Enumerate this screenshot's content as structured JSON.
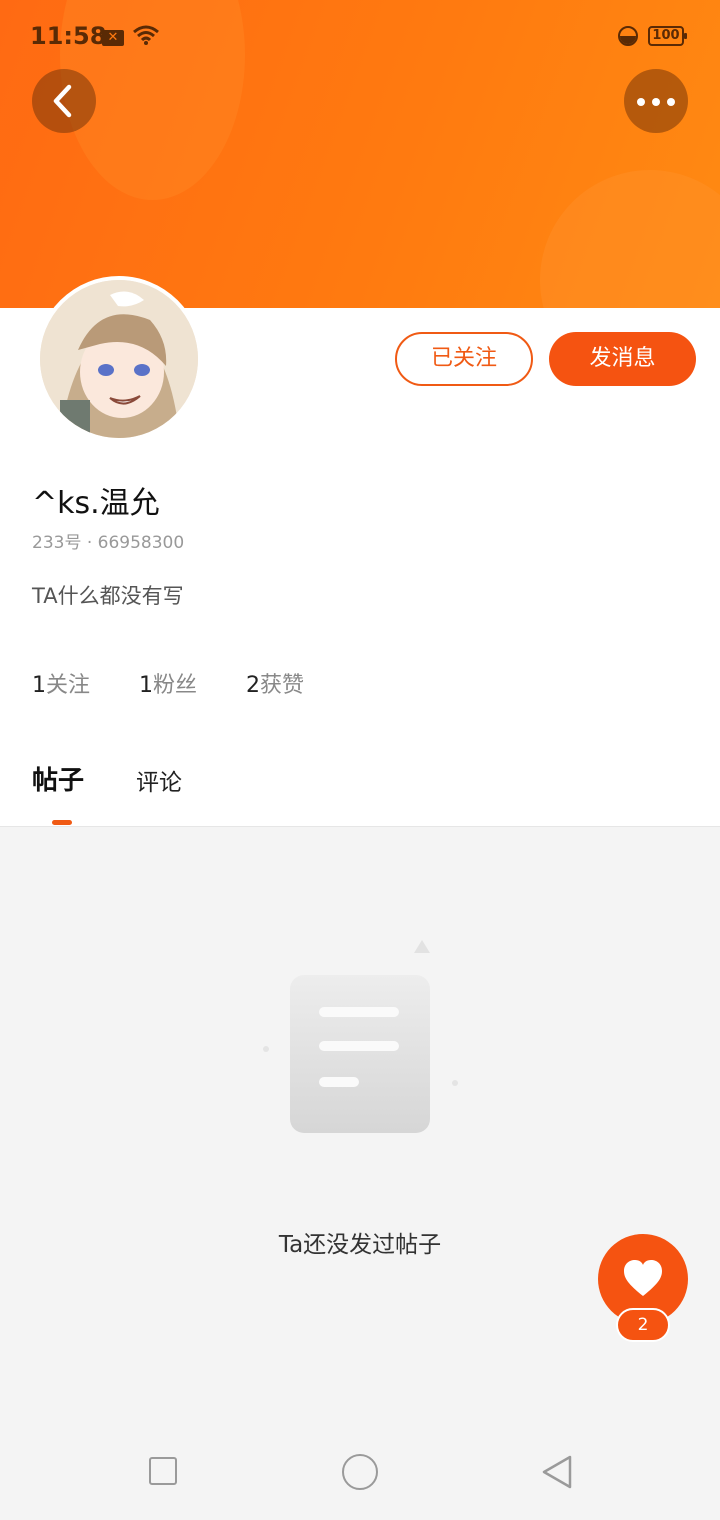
{
  "status_bar": {
    "time": "11:58",
    "battery": "100"
  },
  "profile": {
    "username": "^ks.温允",
    "uid_label": "233号 · 66958300",
    "bio": "TA什么都没有写",
    "follow_button": "已关注",
    "message_button": "发消息",
    "stats": [
      {
        "count": "1",
        "label": "关注"
      },
      {
        "count": "1",
        "label": "粉丝"
      },
      {
        "count": "2",
        "label": "获赞"
      }
    ]
  },
  "tabs": [
    "帖子",
    "评论"
  ],
  "empty_state": {
    "text": "Ta还没发过帖子"
  },
  "like_fab": {
    "count": "2"
  },
  "colors": {
    "accent": "#f55311",
    "header": "#ff7a10"
  },
  "icons": {
    "back": "chevron-left-icon",
    "more": "more-horizontal-icon",
    "like": "heart-icon"
  }
}
